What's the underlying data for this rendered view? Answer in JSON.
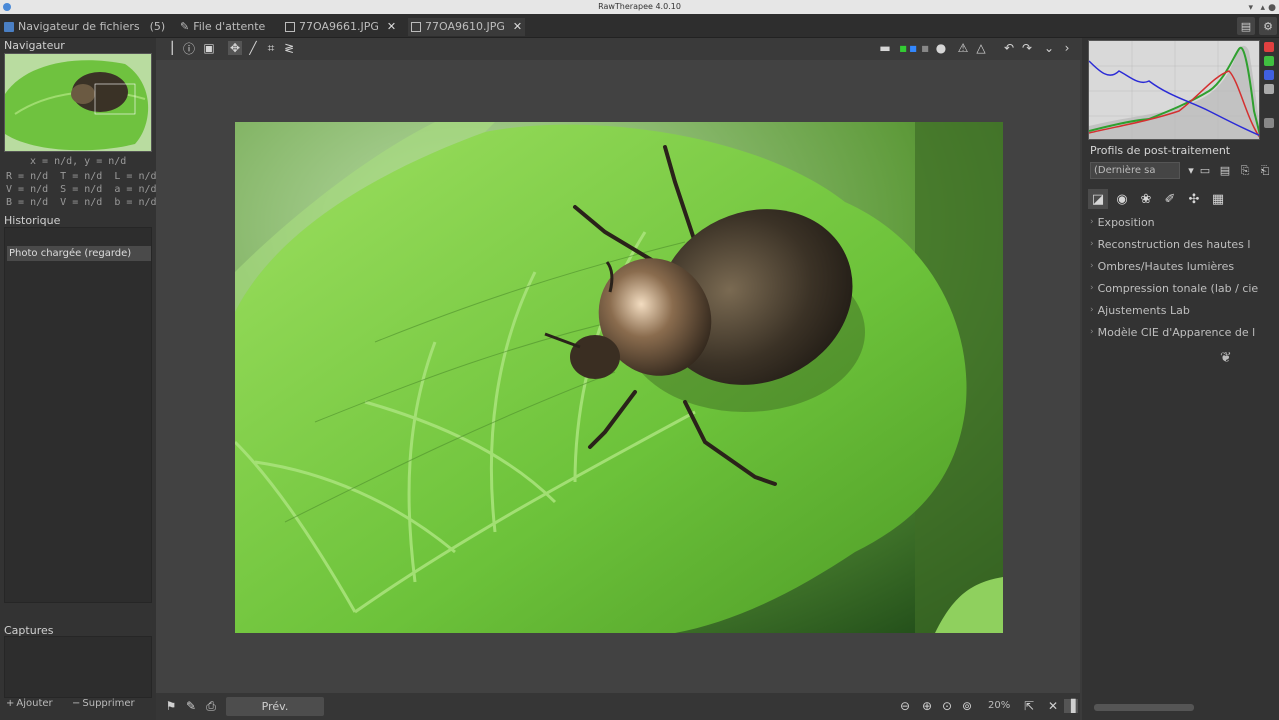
{
  "window": {
    "title": "RawTherapee 4.0.10"
  },
  "tabs": [
    {
      "label": "Navigateur de fichiers",
      "count": "(5)",
      "icon": "folder-icon"
    },
    {
      "label": "File d'attente",
      "icon": "queue-icon"
    },
    {
      "label": "77OA9661.JPG",
      "icon": "image-icon"
    },
    {
      "label": "77OA9610.JPG",
      "icon": "image-icon"
    }
  ],
  "left": {
    "navigator_title": "Navigateur",
    "coords": "x = n/d, y = n/d",
    "info_lines": [
      "R = n/d  T = n/d  L = n/d",
      "V = n/d  S = n/d  a = n/d",
      "B = n/d  V = n/d  b = n/d"
    ],
    "history_title": "Historique",
    "history_item": "Photo chargée (regarde)",
    "captures_title": "Captures",
    "add_label": "Ajouter",
    "remove_label": "Supprimer"
  },
  "bottom": {
    "preview_label": "Prév.",
    "zoom": "20%"
  },
  "right": {
    "pp_title": "Profils de post-traitement",
    "pp_combo": "(Dernière sa",
    "tools": [
      "Exposition",
      "Reconstruction des hautes l",
      "Ombres/Hautes lumières",
      "Compression tonale (lab / cie",
      "Ajustements Lab",
      "Modèle CIE d'Apparence de l"
    ]
  },
  "colors": {
    "accent": "#7aa33a",
    "panel": "#333333",
    "canvas": "#424242"
  }
}
